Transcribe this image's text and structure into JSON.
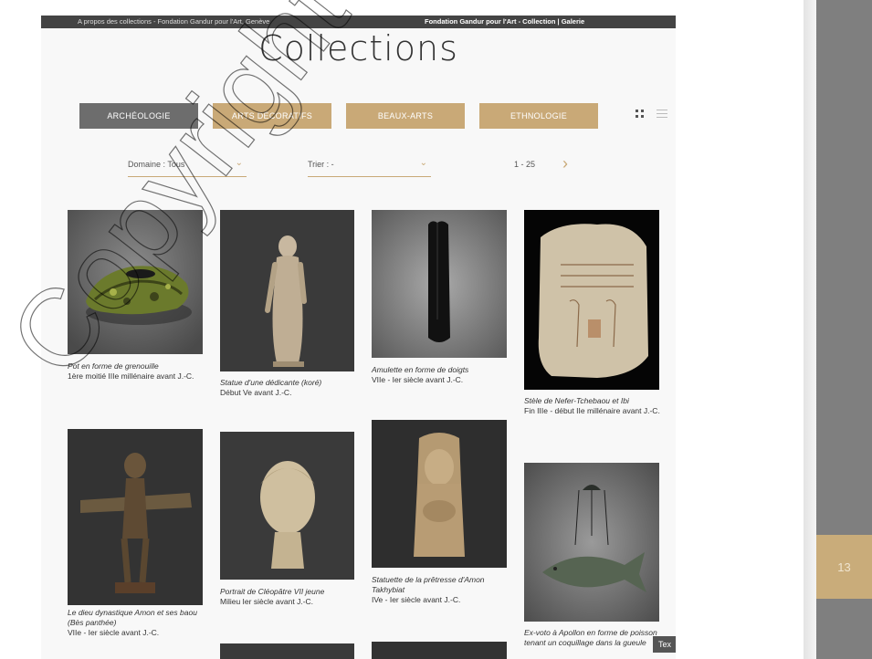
{
  "slide": {
    "page_number": "13"
  },
  "browser_bar": {
    "left_title": "A propos des collections - Fondation Gandur pour l'Art, Genève",
    "right_title": "Fondation Gandur pour l'Art - Collection | Galerie"
  },
  "page": {
    "title": "Collections"
  },
  "categories": [
    {
      "label": "ARCHÉOLOGIE",
      "active": true
    },
    {
      "label": "ARTS DÉCORATIFS",
      "active": false
    },
    {
      "label": "BEAUX-ARTS",
      "active": false
    },
    {
      "label": "ETHNOLOGIE",
      "active": false
    }
  ],
  "filters": {
    "domain_label": "Domaine : Tous",
    "sort_label": "Trier : -",
    "pagination": "1 - 25"
  },
  "items": [
    {
      "title": "Pot en forme de grenouille",
      "date": "1ère moitié IIIe millénaire avant J.-C."
    },
    {
      "title": "Statue d'une dédicante (koré)",
      "date": "Début Ve avant J.-C."
    },
    {
      "title": "Amulette en forme de doigts",
      "date": "VIIe - Ier siècle avant J.-C."
    },
    {
      "title": "Stèle de Nefer-Tchebaou et Ibi",
      "date": "Fin IIIe - début IIe millénaire avant J.-C."
    },
    {
      "title": "Le dieu dynastique Amon et ses baou (Bès panthée)",
      "date": "VIIe - Ier siècle avant J.-C."
    },
    {
      "title": "Portrait de Cléopâtre VII jeune",
      "date": "Milieu Ier siècle avant J.-C."
    },
    {
      "title": "Statuette de la prêtresse d'Amon Takhybiat",
      "date": "IVe - Ier siècle avant J.-C."
    },
    {
      "title": "Ex-voto à Apollon en forme de poisson tenant un coquillage dans la gueule",
      "date": ""
    }
  ],
  "tooltip": {
    "label": "Tex"
  },
  "watermark": {
    "text": "Copyright of Forose"
  },
  "colors": {
    "accent": "#c9a977",
    "active": "#6d6d6d",
    "side_bar": "#7f7f7f"
  }
}
